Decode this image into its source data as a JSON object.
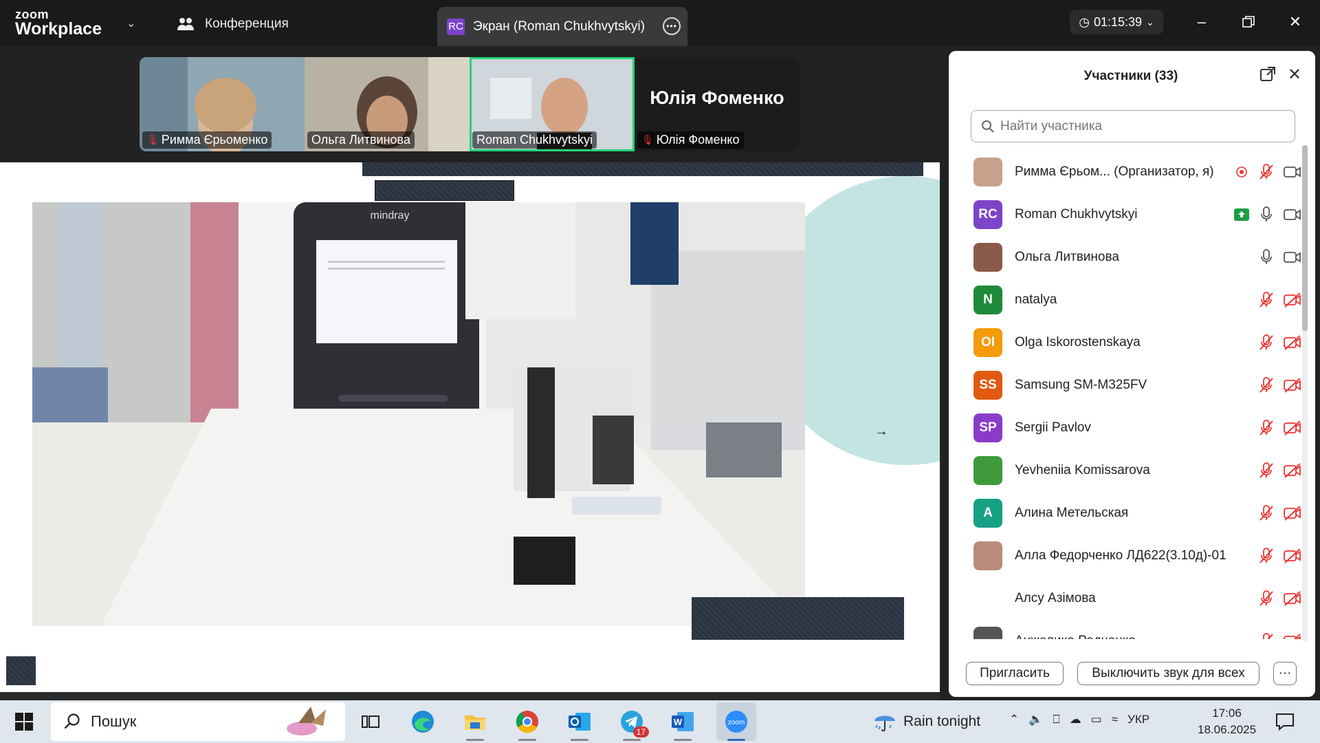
{
  "titlebar": {
    "logo_top": "zoom",
    "logo_bottom": "Workplace",
    "conference_label": "Конференция",
    "share_badge": "RC",
    "share_tab_label": "Экран (Roman Chukhvytskyi)",
    "timer": "01:15:39"
  },
  "thumbnails": [
    {
      "name": "Римма Єрьоменко",
      "muted": true
    },
    {
      "name": "Ольга Литвинова",
      "muted": false
    },
    {
      "name": "Roman Chukhvytskyi",
      "muted": false,
      "active": true
    },
    {
      "name": "Юлія Фоменко",
      "muted": true,
      "big_text": "Юлія Фоменко"
    }
  ],
  "shared_screen": {
    "device_brand": "mindray"
  },
  "participants": {
    "title": "Участники (33)",
    "search_placeholder": "Найти участника",
    "list": [
      {
        "name": "Римма Єрьом... (Организатор, я)",
        "avatar": "",
        "avatar_color": "#c9a08a",
        "mic": "muted",
        "video": "on",
        "recording": true
      },
      {
        "name": "Roman Chukhvytskyi",
        "avatar": "RC",
        "avatar_color": "#7d44c9",
        "mic": "on",
        "video": "on",
        "sharing": true
      },
      {
        "name": "Ольга Литвинова",
        "avatar": "",
        "avatar_color": "#8a5a48",
        "mic": "on",
        "video": "on"
      },
      {
        "name": "natalya",
        "avatar": "N",
        "avatar_color": "#1f8a3a",
        "mic": "muted",
        "video": "off"
      },
      {
        "name": "Olga Iskorostenskaya",
        "avatar": "OI",
        "avatar_color": "#f59b0b",
        "mic": "muted",
        "video": "off"
      },
      {
        "name": "Samsung SM-M325FV",
        "avatar": "SS",
        "avatar_color": "#e05a12",
        "mic": "muted",
        "video": "off"
      },
      {
        "name": "Sergii Pavlov",
        "avatar": "SP",
        "avatar_color": "#8a3cc9",
        "mic": "muted",
        "video": "off"
      },
      {
        "name": "Yevheniia Komissarova",
        "avatar": "",
        "avatar_color": "#3e9a3a",
        "mic": "muted",
        "video": "off"
      },
      {
        "name": "Алина Метельская",
        "avatar": "A",
        "avatar_color": "#16a085",
        "mic": "muted",
        "video": "off"
      },
      {
        "name": "Алла Федорченко ЛД622(3.10д)-01",
        "avatar": "",
        "avatar_color": "#b98b7a",
        "mic": "muted",
        "video": "off"
      },
      {
        "name": "Алсу Азімова",
        "avatar": "",
        "avatar_color": "#ffffff",
        "mic": "muted",
        "video": "off"
      },
      {
        "name": "Анжелика Радченко",
        "avatar": "",
        "avatar_color": "#555555",
        "mic": "muted",
        "video": "off"
      }
    ],
    "invite_button": "Пригласить",
    "mute_all_button": "Выключить звук для всех",
    "more_button": "···"
  },
  "taskbar": {
    "search_label": "Пошук",
    "telegram_badge": "17",
    "weather": "Rain tonight",
    "language": "УКР",
    "time": "17:06",
    "date": "18.06.2025"
  }
}
